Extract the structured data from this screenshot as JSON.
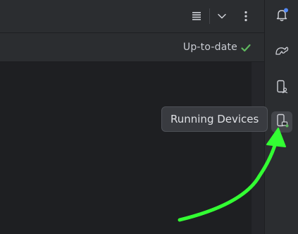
{
  "toolbar": {
    "icons": [
      "list-icon",
      "chevron-down-icon",
      "more-vertical-icon"
    ]
  },
  "status": {
    "text": "Up-to-date",
    "icon": "check-icon",
    "icon_color": "#5fb85f"
  },
  "right_strip": {
    "items": [
      {
        "name": "notifications-icon",
        "badge_color": "#548af7"
      },
      {
        "name": "gradle-icon"
      },
      {
        "name": "device-manager-icon"
      },
      {
        "name": "running-devices-icon",
        "active": true,
        "badge_color": "#5fb85f"
      }
    ]
  },
  "tooltip": {
    "text": "Running Devices"
  },
  "annotation": {
    "arrow_color": "#33ff33",
    "arrow_icon": "arrow-icon"
  },
  "colors": {
    "background": "#1e1f22",
    "panel": "#2b2d30",
    "tooltip_bg": "#393b40"
  }
}
